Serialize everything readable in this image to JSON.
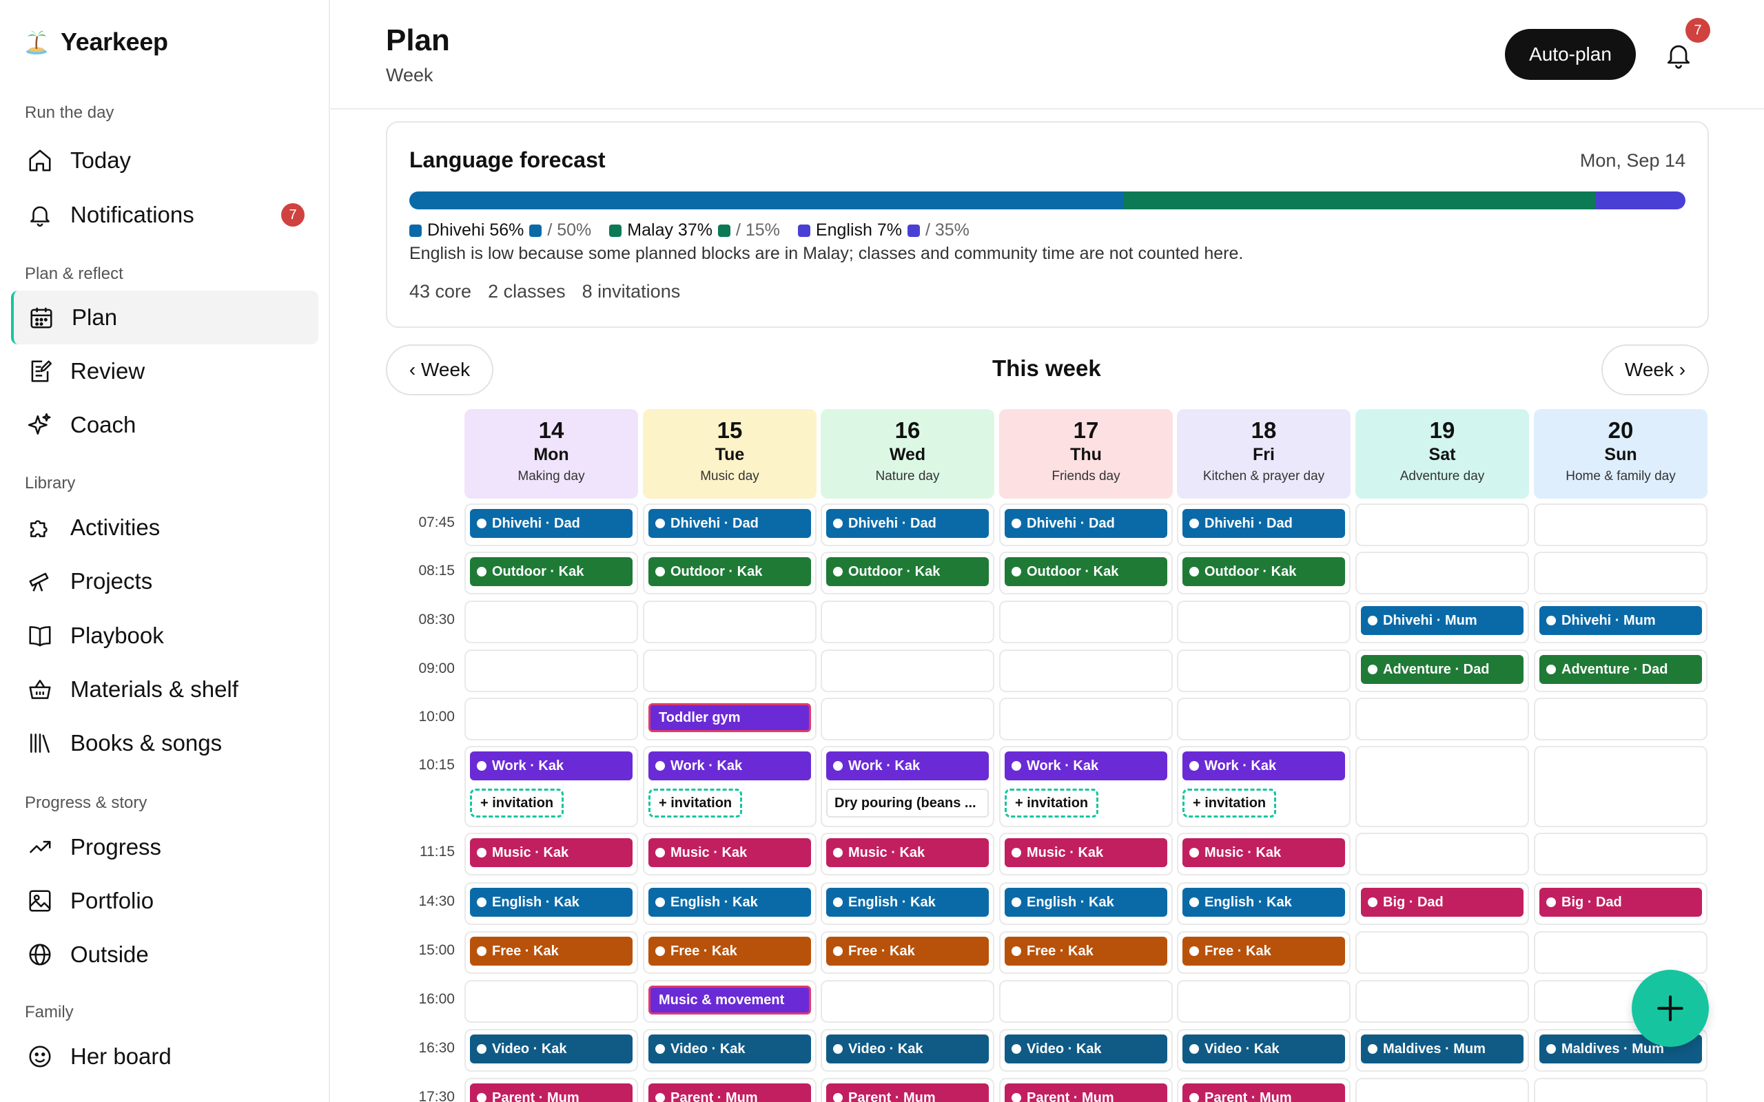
{
  "app": {
    "name": "Yearkeep"
  },
  "sidebar": {
    "sections": [
      {
        "label": "Run the day",
        "items": [
          {
            "label": "Today",
            "icon": "home-icon"
          },
          {
            "label": "Notifications",
            "icon": "bell-icon",
            "badge": "7"
          }
        ]
      },
      {
        "label": "Plan & reflect",
        "items": [
          {
            "label": "Plan",
            "icon": "calendar-icon",
            "active": true
          },
          {
            "label": "Review",
            "icon": "edit-note-icon"
          },
          {
            "label": "Coach",
            "icon": "sparkle-icon"
          }
        ]
      },
      {
        "label": "Library",
        "items": [
          {
            "label": "Activities",
            "icon": "puzzle-icon"
          },
          {
            "label": "Projects",
            "icon": "telescope-icon"
          },
          {
            "label": "Playbook",
            "icon": "book-icon"
          },
          {
            "label": "Materials & shelf",
            "icon": "basket-icon"
          },
          {
            "label": "Books & songs",
            "icon": "library-icon"
          }
        ]
      },
      {
        "label": "Progress & story",
        "items": [
          {
            "label": "Progress",
            "icon": "trend-icon"
          },
          {
            "label": "Portfolio",
            "icon": "image-icon"
          },
          {
            "label": "Outside",
            "icon": "globe-icon"
          }
        ]
      },
      {
        "label": "Family",
        "items": [
          {
            "label": "Her board",
            "icon": "smile-icon"
          }
        ]
      }
    ]
  },
  "header": {
    "title": "Plan",
    "subtitle": "Week",
    "autoplan_label": "Auto-plan",
    "notification_count": "7"
  },
  "forecast": {
    "title": "Language forecast",
    "date": "Mon, Sep 14",
    "languages": [
      {
        "label": "Dhivehi 56%",
        "target": "/ 50%",
        "color": "#0a6aa8",
        "share": 0.56
      },
      {
        "label": "Malay 37%",
        "target": "/ 15%",
        "color": "#0b7a55",
        "share": 0.37
      },
      {
        "label": "English 7%",
        "target": "/ 35%",
        "color": "#4a3fd4",
        "share": 0.07
      }
    ],
    "note": "English is low because some planned blocks are in Malay; classes and community time are not counted here.",
    "stats": [
      "43 core",
      "2 classes",
      "8 invitations"
    ]
  },
  "week": {
    "prev_label": "‹ Week",
    "title": "This week",
    "next_label": "Week ›",
    "days": [
      {
        "num": "14",
        "name": "Mon",
        "theme": "Making day",
        "color": "#efe4fb"
      },
      {
        "num": "15",
        "name": "Tue",
        "theme": "Music day",
        "color": "#fdf3c9"
      },
      {
        "num": "16",
        "name": "Wed",
        "theme": "Nature day",
        "color": "#dcf8e5"
      },
      {
        "num": "17",
        "name": "Thu",
        "theme": "Friends day",
        "color": "#fde0e2"
      },
      {
        "num": "18",
        "name": "Fri",
        "theme": "Kitchen & prayer day",
        "color": "#ece8fc"
      },
      {
        "num": "19",
        "name": "Sat",
        "theme": "Adventure day",
        "color": "#d2f6ef"
      },
      {
        "num": "20",
        "name": "Sun",
        "theme": "Home & family day",
        "color": "#dfeefc"
      }
    ],
    "rows": [
      {
        "time": "07:45",
        "cells": [
          [
            {
              "type": "block",
              "label": "Dhivehi · Dad",
              "color": "#0a6aa8"
            }
          ],
          [
            {
              "type": "block",
              "label": "Dhivehi · Dad",
              "color": "#0a6aa8"
            }
          ],
          [
            {
              "type": "block",
              "label": "Dhivehi · Dad",
              "color": "#0a6aa8"
            }
          ],
          [
            {
              "type": "block",
              "label": "Dhivehi · Dad",
              "color": "#0a6aa8"
            }
          ],
          [
            {
              "type": "block",
              "label": "Dhivehi · Dad",
              "color": "#0a6aa8"
            }
          ],
          [],
          []
        ]
      },
      {
        "time": "08:15",
        "cells": [
          [
            {
              "type": "block",
              "label": "Outdoor · Kak",
              "color": "#1f7a36"
            }
          ],
          [
            {
              "type": "block",
              "label": "Outdoor · Kak",
              "color": "#1f7a36"
            }
          ],
          [
            {
              "type": "block",
              "label": "Outdoor · Kak",
              "color": "#1f7a36"
            }
          ],
          [
            {
              "type": "block",
              "label": "Outdoor · Kak",
              "color": "#1f7a36"
            }
          ],
          [
            {
              "type": "block",
              "label": "Outdoor · Kak",
              "color": "#1f7a36"
            }
          ],
          [],
          []
        ]
      },
      {
        "time": "08:30",
        "cells": [
          [],
          [],
          [],
          [],
          [],
          [
            {
              "type": "block",
              "label": "Dhivehi · Mum",
              "color": "#0a6aa8"
            }
          ],
          [
            {
              "type": "block",
              "label": "Dhivehi · Mum",
              "color": "#0a6aa8"
            }
          ]
        ]
      },
      {
        "time": "09:00",
        "cells": [
          [],
          [],
          [],
          [],
          [],
          [
            {
              "type": "block",
              "label": "Adventure · Dad",
              "color": "#1f7a36"
            }
          ],
          [
            {
              "type": "block",
              "label": "Adventure · Dad",
              "color": "#1f7a36"
            }
          ]
        ]
      },
      {
        "time": "10:00",
        "cells": [
          [],
          [
            {
              "type": "class",
              "label": "Toddler gym",
              "color": "#6a2bd6"
            }
          ],
          [],
          [],
          [],
          [],
          []
        ]
      },
      {
        "time": "10:15",
        "cells": [
          [
            {
              "type": "block",
              "label": "Work · Kak",
              "color": "#6a2bd6"
            },
            {
              "type": "invite",
              "label": "+ invitation"
            }
          ],
          [
            {
              "type": "block",
              "label": "Work · Kak",
              "color": "#6a2bd6"
            },
            {
              "type": "invite",
              "label": "+ invitation"
            }
          ],
          [
            {
              "type": "block",
              "label": "Work · Kak",
              "color": "#6a2bd6"
            },
            {
              "type": "note",
              "label": "Dry pouring (beans ..."
            }
          ],
          [
            {
              "type": "block",
              "label": "Work · Kak",
              "color": "#6a2bd6"
            },
            {
              "type": "invite",
              "label": "+ invitation"
            }
          ],
          [
            {
              "type": "block",
              "label": "Work · Kak",
              "color": "#6a2bd6"
            },
            {
              "type": "invite",
              "label": "+ invitation"
            }
          ],
          [],
          []
        ]
      },
      {
        "time": "11:15",
        "cells": [
          [
            {
              "type": "block",
              "label": "Music · Kak",
              "color": "#c21f60"
            }
          ],
          [
            {
              "type": "block",
              "label": "Music · Kak",
              "color": "#c21f60"
            }
          ],
          [
            {
              "type": "block",
              "label": "Music · Kak",
              "color": "#c21f60"
            }
          ],
          [
            {
              "type": "block",
              "label": "Music · Kak",
              "color": "#c21f60"
            }
          ],
          [
            {
              "type": "block",
              "label": "Music · Kak",
              "color": "#c21f60"
            }
          ],
          [],
          []
        ]
      },
      {
        "time": "14:30",
        "cells": [
          [
            {
              "type": "block",
              "label": "English · Kak",
              "color": "#0a6aa8"
            }
          ],
          [
            {
              "type": "block",
              "label": "English · Kak",
              "color": "#0a6aa8"
            }
          ],
          [
            {
              "type": "block",
              "label": "English · Kak",
              "color": "#0a6aa8"
            }
          ],
          [
            {
              "type": "block",
              "label": "English · Kak",
              "color": "#0a6aa8"
            }
          ],
          [
            {
              "type": "block",
              "label": "English · Kak",
              "color": "#0a6aa8"
            }
          ],
          [
            {
              "type": "block",
              "label": "Big · Dad",
              "color": "#c21f60"
            }
          ],
          [
            {
              "type": "block",
              "label": "Big · Dad",
              "color": "#c21f60"
            }
          ]
        ]
      },
      {
        "time": "15:00",
        "cells": [
          [
            {
              "type": "block",
              "label": "Free · Kak",
              "color": "#b8520b"
            }
          ],
          [
            {
              "type": "block",
              "label": "Free · Kak",
              "color": "#b8520b"
            }
          ],
          [
            {
              "type": "block",
              "label": "Free · Kak",
              "color": "#b8520b"
            }
          ],
          [
            {
              "type": "block",
              "label": "Free · Kak",
              "color": "#b8520b"
            }
          ],
          [
            {
              "type": "block",
              "label": "Free · Kak",
              "color": "#b8520b"
            }
          ],
          [],
          []
        ]
      },
      {
        "time": "16:00",
        "cells": [
          [],
          [
            {
              "type": "class",
              "label": "Music & movement",
              "color": "#6a2bd6"
            }
          ],
          [],
          [],
          [],
          [],
          []
        ]
      },
      {
        "time": "16:30",
        "cells": [
          [
            {
              "type": "block",
              "label": "Video · Kak",
              "color": "#0f5b86"
            }
          ],
          [
            {
              "type": "block",
              "label": "Video · Kak",
              "color": "#0f5b86"
            }
          ],
          [
            {
              "type": "block",
              "label": "Video · Kak",
              "color": "#0f5b86"
            }
          ],
          [
            {
              "type": "block",
              "label": "Video · Kak",
              "color": "#0f5b86"
            }
          ],
          [
            {
              "type": "block",
              "label": "Video · Kak",
              "color": "#0f5b86"
            }
          ],
          [
            {
              "type": "block",
              "label": "Maldives · Mum",
              "color": "#0f5b86"
            }
          ],
          [
            {
              "type": "block",
              "label": "Maldives · Mum",
              "color": "#0f5b86"
            }
          ]
        ]
      },
      {
        "time": "17:30",
        "cells": [
          [
            {
              "type": "block",
              "label": "Parent · Mum",
              "color": "#c21f60"
            }
          ],
          [
            {
              "type": "block",
              "label": "Parent · Mum",
              "color": "#c21f60"
            }
          ],
          [
            {
              "type": "block",
              "label": "Parent · Mum",
              "color": "#c21f60"
            }
          ],
          [
            {
              "type": "block",
              "label": "Parent · Mum",
              "color": "#c21f60"
            }
          ],
          [
            {
              "type": "block",
              "label": "Parent · Mum",
              "color": "#c21f60"
            }
          ],
          [],
          []
        ]
      }
    ]
  }
}
